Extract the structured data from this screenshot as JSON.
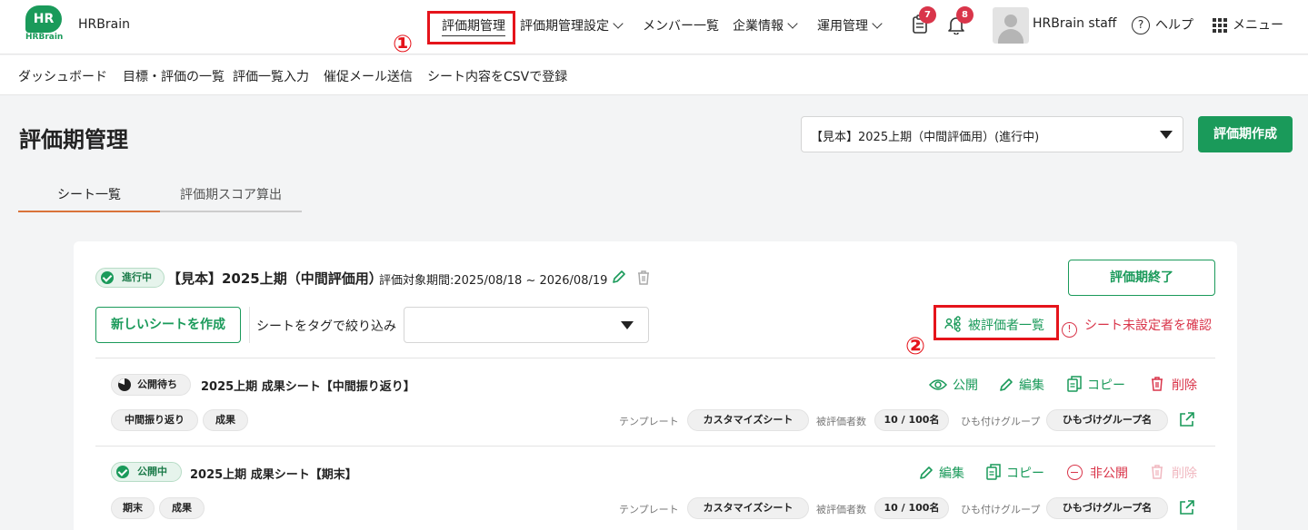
{
  "header": {
    "brand": "HRBrain",
    "logo_main": "HR",
    "logo_sub": "HRBrain",
    "nav": {
      "period_mgmt": "評価期管理",
      "period_settings": "評価期管理設定",
      "members": "メンバー一覧",
      "company": "企業情報",
      "operations": "運用管理"
    },
    "task_badge": "7",
    "notify_badge": "8",
    "user_name": "HRBrain staff",
    "help": "ヘルプ",
    "menu": "メニュー"
  },
  "subnav": [
    "ダッシュボード",
    "目標・評価の一覧",
    "評価一覧入力",
    "催促メール送信",
    "シート内容をCSVで登録"
  ],
  "page": {
    "title": "評価期管理",
    "period_select": "【見本】2025上期（中間評価用）(進行中)",
    "create_period": "評価期作成"
  },
  "tabs": [
    "シート一覧",
    "評価期スコア算出"
  ],
  "callouts": [
    "①",
    "②"
  ],
  "period_card": {
    "status": "進行中",
    "title": "【見本】2025上期（中間評価用）",
    "period": "評価対象期間:2025/08/18 ~ 2026/08/19",
    "end_button": "評価期終了",
    "new_sheet": "新しいシートを作成",
    "filter_label": "シートをタグで絞り込み",
    "filter_value": "",
    "evaluatee_list": "被評価者一覧",
    "check_unset": "シート未設定者を確認"
  },
  "sheets": [
    {
      "status": "公開待ち",
      "title": "2025上期 成果シート【中間振り返り】",
      "actions": {
        "publish": "公開",
        "edit": "編集",
        "copy": "コピー",
        "delete": "削除"
      },
      "tags": [
        "中間振り返り",
        "成果"
      ],
      "template_label": "テンプレート",
      "template": "カスタマイズシート",
      "count_label": "被評価者数",
      "count": "10 / 100名",
      "group_label": "ひも付けグループ",
      "group": "ひもづけグループ名"
    },
    {
      "status": "公開中",
      "title": "2025上期 成果シート【期末】",
      "actions": {
        "edit": "編集",
        "copy": "コピー",
        "unpublish": "非公開",
        "delete": "削除"
      },
      "tags": [
        "期末",
        "成果"
      ],
      "template_label": "テンプレート",
      "template": "カスタマイズシート",
      "count_label": "被評価者数",
      "count": "10 / 100名",
      "group_label": "ひも付けグループ",
      "group": "ひもづけグループ名"
    }
  ],
  "colors": {
    "brand": "#1a9a5a",
    "danger": "#d9354a",
    "highlight": "#e5141b"
  }
}
